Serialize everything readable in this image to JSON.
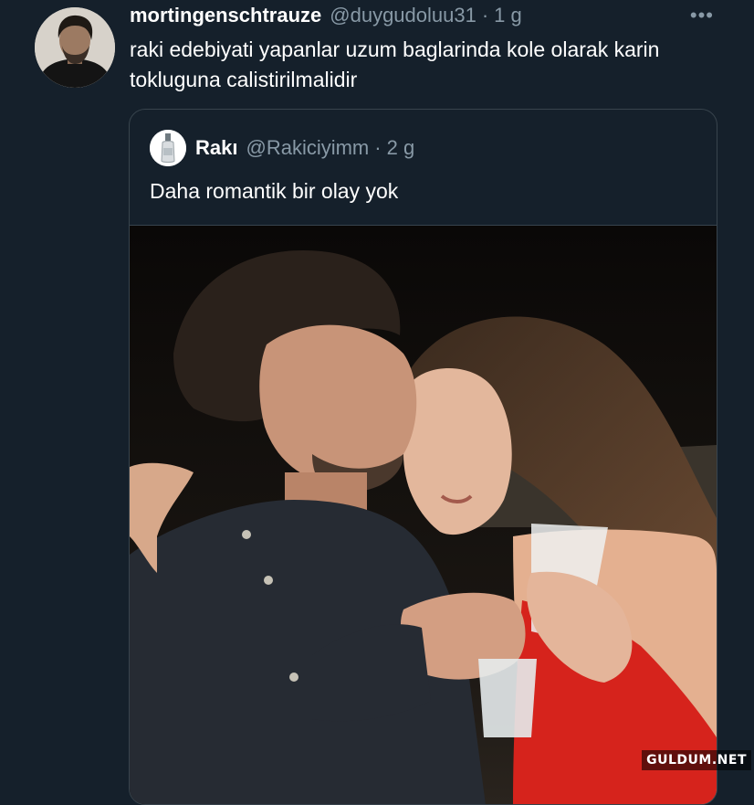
{
  "tweet": {
    "display_name": "mortingenschtrauze",
    "handle": "@duygudoluu31",
    "separator": "·",
    "time": "1 g",
    "more_icon": "•••",
    "text": "raki edebiyati yapanlar uzum baglarinda kole olarak karin tokluguna calistirilmalidir"
  },
  "quoted_tweet": {
    "display_name": "Rakı",
    "handle": "@Rakiciyimm",
    "separator": "·",
    "time": "2 g",
    "text": "Daha romantik bir olay yok"
  },
  "watermark": "GULDUM.NET",
  "colors": {
    "background": "#15202b",
    "secondary_text": "#8899a6",
    "border": "#38444d"
  }
}
